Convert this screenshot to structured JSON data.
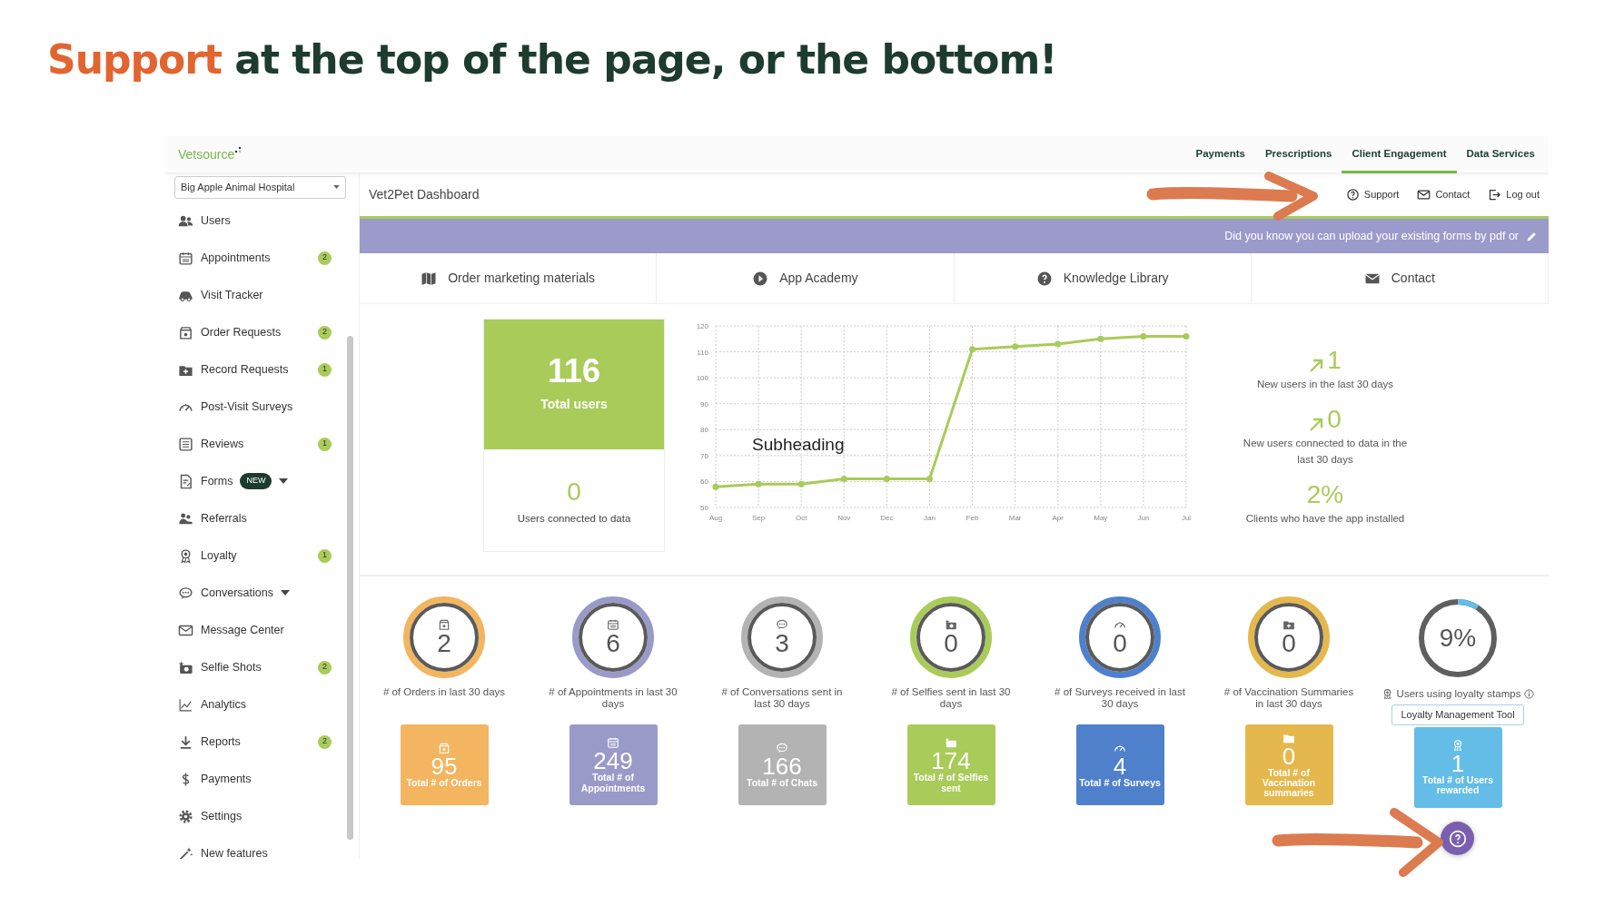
{
  "headline": {
    "highlight": "Support",
    "rest": "at the top of the page, or the bottom!"
  },
  "brand": {
    "name": "Vetsource"
  },
  "top_nav": [
    {
      "label": "Payments",
      "selected": false
    },
    {
      "label": "Prescriptions",
      "selected": false
    },
    {
      "label": "Client Engagement",
      "selected": true
    },
    {
      "label": "Data Services",
      "selected": false
    }
  ],
  "clinic_select": {
    "value": "Big Apple Animal Hospital"
  },
  "sidebar": {
    "items": [
      {
        "label": "Users"
      },
      {
        "label": "Appointments",
        "badge": "2"
      },
      {
        "label": "Visit Tracker"
      },
      {
        "label": "Order Requests",
        "badge": "2"
      },
      {
        "label": "Record Requests",
        "badge": "1"
      },
      {
        "label": "Post-Visit Surveys"
      },
      {
        "label": "Reviews",
        "badge": "1"
      },
      {
        "label": "Forms",
        "tag": "NEW",
        "has_submenu": true
      },
      {
        "label": "Referrals"
      },
      {
        "label": "Loyalty",
        "badge": "1"
      },
      {
        "label": "Conversations",
        "has_submenu": true
      },
      {
        "label": "Message Center"
      },
      {
        "label": "Selfie Shots",
        "badge": "2"
      },
      {
        "label": "Analytics"
      },
      {
        "label": "Reports",
        "badge": "2"
      },
      {
        "label": "Payments"
      },
      {
        "label": "Settings"
      },
      {
        "label": "New features"
      }
    ]
  },
  "page_title": "Vet2Pet Dashboard",
  "header_actions": [
    {
      "label": "Support"
    },
    {
      "label": "Contact"
    },
    {
      "label": "Log out"
    }
  ],
  "banner": {
    "text": "Did you know you can upload your existing forms by pdf or"
  },
  "quick_links": [
    {
      "label": "Order marketing materials"
    },
    {
      "label": "App Academy"
    },
    {
      "label": "Knowledge Library"
    },
    {
      "label": "Contact"
    }
  ],
  "totals": {
    "value": "116",
    "label": "Total users",
    "connected_value": "0",
    "connected_label": "Users connected to data"
  },
  "user_chart": {
    "chart_data": {
      "type": "line",
      "grid": true,
      "categories": [
        "Aug",
        "Sep",
        "Oct",
        "Nov",
        "Dec",
        "Jan",
        "Feb",
        "Mar",
        "Apr",
        "May",
        "Jun",
        "Jul"
      ],
      "ylim": [
        50,
        120
      ],
      "yticks": [
        50,
        60,
        70,
        80,
        90,
        100,
        110,
        120
      ],
      "series": [
        {
          "color": "#a9cb59",
          "marker": "circle",
          "values": [
            58,
            59,
            59,
            61,
            61,
            61,
            111,
            112,
            113,
            115,
            116,
            116
          ]
        }
      ],
      "annotations": [
        "Subheading"
      ]
    }
  },
  "highlights": [
    {
      "value": "1",
      "label": "New users in the last 30 days",
      "arrow": true
    },
    {
      "value": "0",
      "label": "New users connected to data in the last 30 days",
      "arrow": true
    },
    {
      "value": "2%",
      "label": "Clients who have the app installed",
      "arrow": false
    }
  ],
  "metrics": [
    {
      "kind": "ring",
      "value": "2",
      "label": "# of Orders in last 30 days",
      "color": "#f3b55f",
      "tile_value": "95",
      "tile_label": "Total # of Orders"
    },
    {
      "kind": "ring",
      "value": "6",
      "label": "# of Appointments in last 30 days",
      "color": "#9a9ac9",
      "tile_value": "249",
      "tile_label": "Total # of Appointments"
    },
    {
      "kind": "ring",
      "value": "3",
      "label": "# of Conversations sent in last 30 days",
      "color": "#b3b3b3",
      "tile_value": "166",
      "tile_label": "Total # of Chats"
    },
    {
      "kind": "ring",
      "value": "0",
      "label": "# of Selfies sent in last 30 days",
      "color": "#a9cb59",
      "tile_value": "174",
      "tile_label": "Total # of Selfies sent"
    },
    {
      "kind": "ring",
      "value": "0",
      "label": "# of Surveys received in last 30 days",
      "color": "#4f80cc",
      "tile_value": "4",
      "tile_label": "Total # of Surveys"
    },
    {
      "kind": "ring",
      "value": "0",
      "label": "# of Vaccination Summaries in last 30 days",
      "color": "#e4b84c",
      "tile_value": "0",
      "tile_label": "Total # of Vaccination summaries"
    },
    {
      "kind": "progress",
      "value": "9%",
      "level": 0.09,
      "label": "Users using loyalty stamps",
      "button": "Loyalty Management Tool",
      "color": "#63bde6",
      "tile_value": "1",
      "tile_label": "Total # of Users rewarded"
    }
  ]
}
